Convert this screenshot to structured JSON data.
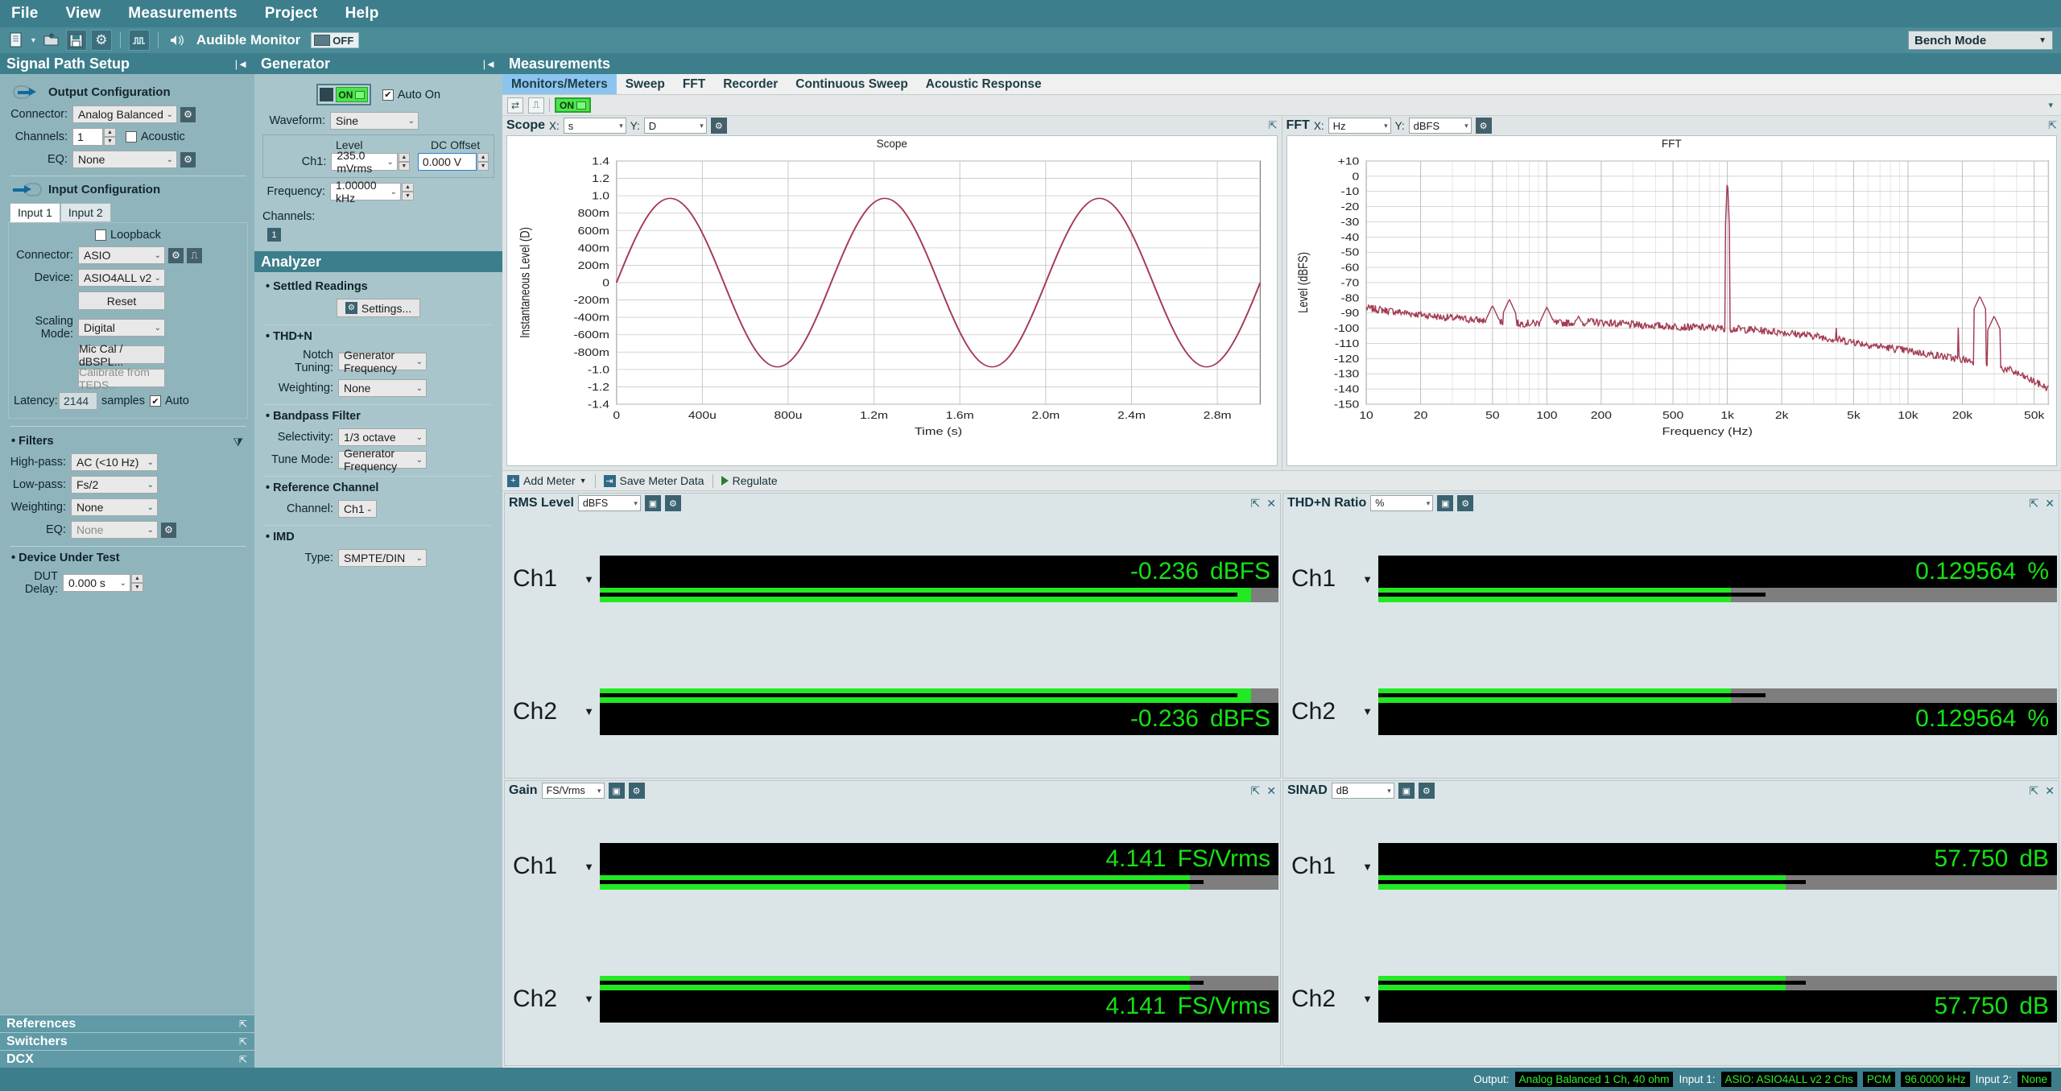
{
  "menubar": {
    "items": [
      "File",
      "View",
      "Measurements",
      "Project",
      "Help"
    ]
  },
  "toolbar": {
    "icons": [
      "new-document-icon",
      "open-project-icon",
      "save-icon",
      "settings-icon",
      "signal-icon",
      "speaker-icon"
    ],
    "audible_monitor_label": "Audible Monitor",
    "monitor_state": "OFF",
    "bench_mode_label": "Bench Mode"
  },
  "signal_path": {
    "title": "Signal Path Setup",
    "output": {
      "title": "Output Configuration",
      "connector_label": "Connector:",
      "connector_value": "Analog Balanced",
      "channels_label": "Channels:",
      "channels_value": "1",
      "acoustic_label": "Acoustic",
      "acoustic_checked": false,
      "eq_label": "EQ:",
      "eq_value": "None"
    },
    "input": {
      "title": "Input Configuration",
      "tabs": [
        "Input 1",
        "Input 2"
      ],
      "active_tab": "Input 1",
      "loopback_label": "Loopback",
      "loopback_checked": false,
      "connector_label": "Connector:",
      "connector_value": "ASIO",
      "device_label": "Device:",
      "device_value": "ASIO4ALL v2",
      "reset_label": "Reset",
      "scaling_label": "Scaling Mode:",
      "scaling_value": "Digital",
      "miccal_label": "Mic Cal / dBSPL...",
      "teds_label": "Calibrate from TEDS..",
      "latency_label": "Latency:",
      "latency_value": "2144",
      "samples_label": "samples",
      "auto_label": "Auto",
      "auto_checked": true
    },
    "filters": {
      "title": "Filters",
      "highpass_label": "High-pass:",
      "highpass_value": "AC (<10 Hz)",
      "lowpass_label": "Low-pass:",
      "lowpass_value": "Fs/2",
      "weighting_label": "Weighting:",
      "weighting_value": "None",
      "eq_label": "EQ:",
      "eq_value": "None"
    },
    "dut": {
      "title": "Device Under Test",
      "delay_label": "DUT Delay:",
      "delay_value": "0.000 s"
    },
    "collapsed": [
      "References",
      "Switchers",
      "DCX"
    ]
  },
  "generator": {
    "title": "Generator",
    "on_label": "ON",
    "auto_on_label": "Auto On",
    "auto_on_checked": true,
    "waveform_label": "Waveform:",
    "waveform_value": "Sine",
    "level_header": "Level",
    "dc_offset_header": "DC Offset",
    "ch1_label": "Ch1:",
    "level_value": "235.0 mVrms",
    "dc_offset_value": "0.000 V",
    "frequency_label": "Frequency:",
    "frequency_value": "1.00000 kHz",
    "channels_label": "Channels:",
    "channel_badge": "1"
  },
  "analyzer": {
    "title": "Analyzer",
    "settled_readings_title": "Settled Readings",
    "settings_label": "Settings...",
    "thdn_title": "THD+N",
    "notch_tuning_label": "Notch Tuning:",
    "notch_tuning_value": "Generator Frequency",
    "weighting_label": "Weighting:",
    "weighting_value": "None",
    "bandpass_title": "Bandpass Filter",
    "selectivity_label": "Selectivity:",
    "selectivity_value": "1/3 octave",
    "tune_mode_label": "Tune Mode:",
    "tune_mode_value": "Generator Frequency",
    "reference_channel_title": "Reference Channel",
    "channel_label": "Channel:",
    "channel_value": "Ch1",
    "imd_title": "IMD",
    "type_label": "Type:",
    "type_value": "SMPTE/DIN"
  },
  "measurements": {
    "title": "Measurements",
    "tabs": [
      "Monitors/Meters",
      "Sweep",
      "FFT",
      "Recorder",
      "Continuous Sweep",
      "Acoustic Response"
    ],
    "active_tab": "Monitors/Meters",
    "monitor_on_label": "ON"
  },
  "scope_panel": {
    "name": "Scope",
    "x_label": "X:",
    "x_value": "s",
    "y_label": "Y:",
    "y_value": "D"
  },
  "fft_panel": {
    "name": "FFT",
    "x_label": "X:",
    "x_value": "Hz",
    "y_label": "Y:",
    "y_value": "dBFS"
  },
  "meter_toolbar": {
    "add_meter": "Add Meter",
    "save_meter_data": "Save Meter Data",
    "regulate": "Regulate"
  },
  "meters": [
    {
      "name": "RMS Level",
      "unit": "dBFS",
      "rows": [
        {
          "channel": "Ch1",
          "value": "-0.236",
          "unit": "dBFS",
          "bar_pct": 96,
          "needle_pct": 94
        },
        {
          "channel": "Ch2",
          "value": "-0.236",
          "unit": "dBFS",
          "bar_pct": 96,
          "needle_pct": 94
        }
      ]
    },
    {
      "name": "THD+N Ratio",
      "unit": "%",
      "rows": [
        {
          "channel": "Ch1",
          "value": "0.129564",
          "unit": "%",
          "bar_pct": 52,
          "needle_pct": 57
        },
        {
          "channel": "Ch2",
          "value": "0.129564",
          "unit": "%",
          "bar_pct": 52,
          "needle_pct": 57
        }
      ]
    },
    {
      "name": "Gain",
      "unit": "FS/Vrms",
      "rows": [
        {
          "channel": "Ch1",
          "value": "4.141",
          "unit": "FS/Vrms",
          "bar_pct": 87,
          "needle_pct": 89
        },
        {
          "channel": "Ch2",
          "value": "4.141",
          "unit": "FS/Vrms",
          "bar_pct": 87,
          "needle_pct": 89
        }
      ]
    },
    {
      "name": "SINAD",
      "unit": "dB",
      "rows": [
        {
          "channel": "Ch1",
          "value": "57.750",
          "unit": "dB",
          "bar_pct": 60,
          "needle_pct": 63
        },
        {
          "channel": "Ch2",
          "value": "57.750",
          "unit": "dB",
          "bar_pct": 60,
          "needle_pct": 63
        }
      ]
    }
  ],
  "statusbar": {
    "output_label": "Output:",
    "output_value": "Analog Balanced 1 Ch, 40 ohm",
    "input1_label": "Input 1:",
    "input1_value": "ASIO: ASIO4ALL v2 2 Chs",
    "pcm_value": "PCM",
    "rate_value": "96.0000 kHz",
    "input2_label": "Input 2:",
    "input2_value": "None"
  },
  "chart_data": [
    {
      "type": "line",
      "title": "Scope",
      "xlabel": "Time (s)",
      "ylabel": "Instantaneous Level (D)",
      "xlim": [
        0,
        0.003
      ],
      "ylim": [
        -1.4,
        1.4
      ],
      "xticks": [
        "0",
        "400u",
        "800u",
        "1.2m",
        "1.6m",
        "2.0m",
        "2.4m",
        "2.8m"
      ],
      "xtick_values": [
        0,
        0.0004,
        0.0008,
        0.0012,
        0.0016,
        0.002,
        0.0024,
        0.0028
      ],
      "yticks": [
        "1.4",
        "1.2",
        "1.0",
        "800m",
        "600m",
        "400m",
        "200m",
        "0",
        "-200m",
        "-400m",
        "-600m",
        "-800m",
        "-1.0",
        "-1.2",
        "-1.4"
      ],
      "ytick_values": [
        1.4,
        1.2,
        1.0,
        0.8,
        0.6,
        0.4,
        0.2,
        0,
        -0.2,
        -0.4,
        -0.6,
        -0.8,
        -1.0,
        -1.2,
        -1.4
      ],
      "grid": true,
      "series": [
        {
          "name": "Ch1",
          "color": "#a33b52",
          "waveform": "sine",
          "amplitude": 0.97,
          "frequency_hz": 1000,
          "phase": 0
        }
      ]
    },
    {
      "type": "line",
      "title": "FFT",
      "xlabel": "Frequency (Hz)",
      "ylabel": "Level (dBFS)",
      "xscale": "log",
      "xlim": [
        10,
        60000
      ],
      "ylim": [
        -150,
        10
      ],
      "xticks": [
        "10",
        "20",
        "50",
        "100",
        "200",
        "500",
        "1k",
        "2k",
        "5k",
        "10k",
        "20k",
        "50k"
      ],
      "xtick_values": [
        10,
        20,
        50,
        100,
        200,
        500,
        1000,
        2000,
        5000,
        10000,
        20000,
        50000
      ],
      "yticks": [
        "+10",
        "0",
        "-10",
        "-20",
        "-30",
        "-40",
        "-50",
        "-60",
        "-70",
        "-80",
        "-90",
        "-100",
        "-110",
        "-120",
        "-130",
        "-140",
        "-150"
      ],
      "ytick_values": [
        10,
        0,
        -10,
        -20,
        -30,
        -40,
        -50,
        -60,
        -70,
        -80,
        -90,
        -100,
        -110,
        -120,
        -130,
        -140,
        -150
      ],
      "grid": true,
      "series": [
        {
          "name": "Ch1",
          "color": "#a33b52",
          "noise_floor_dbfs": [
            -87,
            -90,
            -93,
            -95,
            -97,
            -97,
            -96,
            -98,
            -99,
            -100,
            -101,
            -103,
            -106,
            -110,
            -114,
            -118,
            -122,
            -128,
            -140
          ],
          "fundamental": {
            "frequency_hz": 1000,
            "level_dbfs": -0.4
          },
          "peaks": [
            {
              "frequency_hz": 50,
              "level_dbfs": -85
            },
            {
              "frequency_hz": 62,
              "level_dbfs": -81
            },
            {
              "frequency_hz": 100,
              "level_dbfs": -86
            },
            {
              "frequency_hz": 150,
              "level_dbfs": -92
            },
            {
              "frequency_hz": 25000,
              "level_dbfs": -79
            },
            {
              "frequency_hz": 30000,
              "level_dbfs": -92
            }
          ]
        }
      ]
    }
  ]
}
